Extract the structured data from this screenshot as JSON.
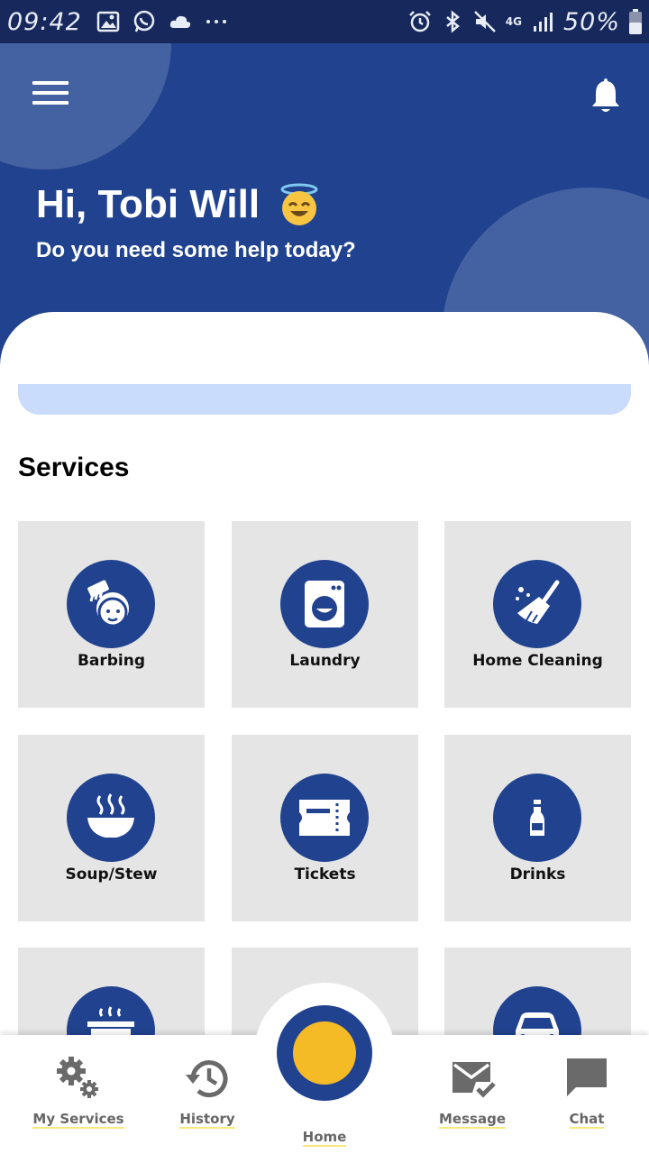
{
  "status_bar": {
    "time": "09:42",
    "network": "4G",
    "battery_percent": "50%",
    "left_icons": [
      "image-icon",
      "whatsapp-icon",
      "cloud-icon",
      "more-dots-icon"
    ],
    "right_icons": [
      "alarm-icon",
      "bluetooth-icon",
      "mute-icon",
      "network-4g-icon",
      "signal-icon",
      "battery-icon"
    ]
  },
  "header": {
    "greeting": "Hi, Tobi Will",
    "greeting_emoji": "smiling-face-with-halo",
    "subtitle": "Do you need some help today?",
    "menu_icon": "hamburger-menu-icon",
    "notification_icon": "bell-icon"
  },
  "search": {
    "placeholder": ""
  },
  "services": {
    "title": "Services",
    "items": [
      {
        "label": "Barbing",
        "icon": "barber-face-comb-icon"
      },
      {
        "label": "Laundry",
        "icon": "washing-machine-icon"
      },
      {
        "label": "Home Cleaning",
        "icon": "broom-icon"
      },
      {
        "label": "Soup/Stew",
        "icon": "steaming-bowl-icon"
      },
      {
        "label": "Tickets",
        "icon": "ticket-icon"
      },
      {
        "label": "Drinks",
        "icon": "bottle-icon"
      },
      {
        "label": "",
        "icon": "cooking-pot-icon"
      },
      {
        "label": "",
        "icon": ""
      },
      {
        "label": "",
        "icon": "car-icon"
      }
    ]
  },
  "bottom_nav": {
    "items": [
      {
        "label": "My Services",
        "icon": "gears-icon"
      },
      {
        "label": "History",
        "icon": "history-clock-icon"
      },
      {
        "label": "Home",
        "icon": "home-circle-icon"
      },
      {
        "label": "Message",
        "icon": "mail-check-icon"
      },
      {
        "label": "Chat",
        "icon": "chat-bubble-icon"
      }
    ]
  },
  "colors": {
    "primary": "#21438f",
    "status_bar": "#17295c",
    "accent_yellow": "#f5bb26",
    "tile_bg": "#e5e5e5",
    "search_bg": "#cadcfb"
  }
}
